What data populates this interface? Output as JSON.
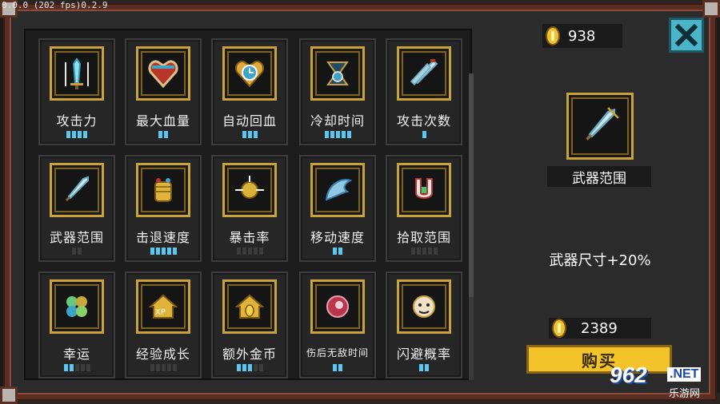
{
  "debug": {
    "fps_text": "0.0.0 (202 fps)0.2.9"
  },
  "coins": {
    "top_value": "938",
    "price_value": "2389"
  },
  "close_button": {
    "icon": "close-x-icon"
  },
  "upgrades": [
    {
      "label": "攻击力",
      "icon": "sword-icon",
      "level": 4,
      "max": 4
    },
    {
      "label": "最大血量",
      "icon": "heart-icon",
      "level": 2,
      "max": 2
    },
    {
      "label": "自动回血",
      "icon": "heart-clock-icon",
      "level": 3,
      "max": 3
    },
    {
      "label": "冷却时间",
      "icon": "hourglass-icon",
      "level": 5,
      "max": 5
    },
    {
      "label": "攻击次数",
      "icon": "double-sword-icon",
      "level": 1,
      "max": 1
    },
    {
      "label": "武器范围",
      "icon": "weapon-range-icon",
      "level": 0,
      "max": 2
    },
    {
      "label": "击退速度",
      "icon": "fist-icon",
      "level": 5,
      "max": 5
    },
    {
      "label": "暴击率",
      "icon": "crit-orb-icon",
      "level": 0,
      "max": 5
    },
    {
      "label": "移动速度",
      "icon": "wing-icon",
      "level": 2,
      "max": 2
    },
    {
      "label": "拾取范围",
      "icon": "magnet-icon",
      "level": 0,
      "max": 5
    },
    {
      "label": "幸运",
      "icon": "clover-icon",
      "level": 2,
      "max": 5
    },
    {
      "label": "经验成长",
      "icon": "xp-icon",
      "level": 0,
      "max": 5
    },
    {
      "label": "额外金币",
      "icon": "coin-house-icon",
      "level": 3,
      "max": 5
    },
    {
      "label": "伤后无敌时间",
      "icon": "shield-orb-icon",
      "level": 2,
      "max": 2
    },
    {
      "label": "闪避概率",
      "icon": "dodge-icon",
      "level": 2,
      "max": 2
    }
  ],
  "detail": {
    "name": "武器范围",
    "icon": "weapon-range-icon",
    "description": "武器尺寸+20%"
  },
  "buy_button": {
    "label": "购买"
  },
  "watermark": {
    "number": "962",
    "net": ".NET",
    "cn": "乐游网"
  },
  "colors": {
    "pip_on": "#59c7f0",
    "pip_off": "#3c3c3c",
    "gold_border": "#caa23a",
    "buy": "#f3c32a",
    "close": "#4ab4c9"
  }
}
